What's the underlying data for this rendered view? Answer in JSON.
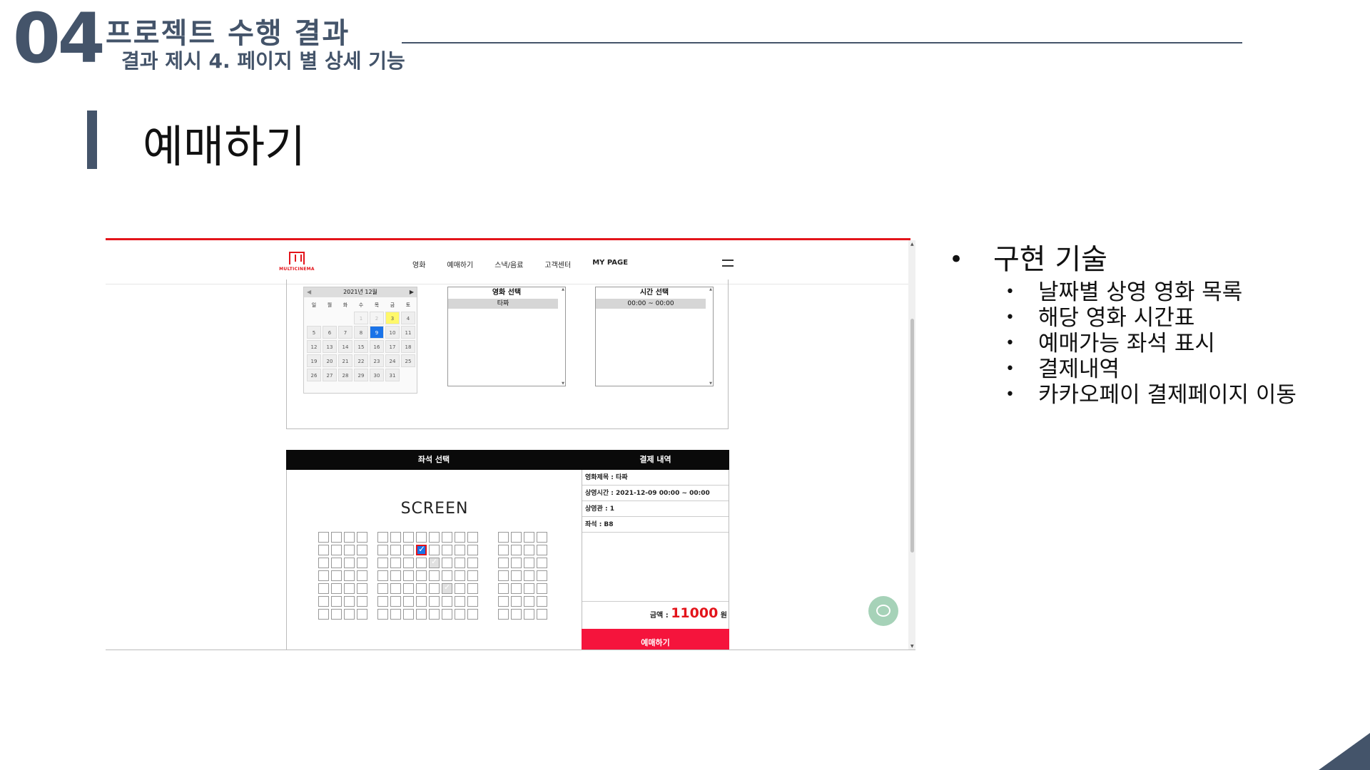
{
  "header": {
    "section_number": "04",
    "section_title": "프로젝트 수행 결과",
    "section_subtitle": "결과 제시 4. 페이지 별 상세 기능"
  },
  "page_title": "예매하기",
  "bullets": {
    "main": "구현 기술",
    "items": [
      "날짜별 상영 영화 목록",
      "해당 영화 시간표",
      "예매가능 좌석 표시",
      "결제내역",
      "카카오페이 결제페이지 이동"
    ]
  },
  "screenshot": {
    "logo_text": "MULTICINEMA",
    "nav": [
      "영화",
      "예매하기",
      "스낵/음료",
      "고객센터",
      "MY PAGE"
    ],
    "calendar": {
      "month_label": "2021년 12월",
      "weekdays": [
        "일",
        "월",
        "화",
        "수",
        "목",
        "금",
        "토"
      ],
      "selected_day": "9",
      "today": "3"
    },
    "movie_select": {
      "title": "영화 선택",
      "selected": "타짜"
    },
    "time_select": {
      "title": "시간 선택",
      "selected": "00:00 ~ 00:00"
    },
    "seat_section": {
      "title": "좌석 선택",
      "screen_label": "SCREEN"
    },
    "payment": {
      "title": "결제 내역",
      "rows": [
        "영화제목 : 타짜",
        "상영시간 : 2021-12-09 00:00 ~ 00:00",
        "상영관 : 1",
        "좌석 : B8"
      ],
      "amount_label": "금액 :",
      "amount": "11000",
      "currency": "원",
      "button": "예매하기"
    }
  },
  "colors": {
    "theme": "#44546a",
    "brand_red": "#e3141b",
    "book_button": "#f5143c",
    "selected_day": "#1a73e8",
    "today_highlight": "#fff86a",
    "chat_button": "#a6d2b8"
  }
}
